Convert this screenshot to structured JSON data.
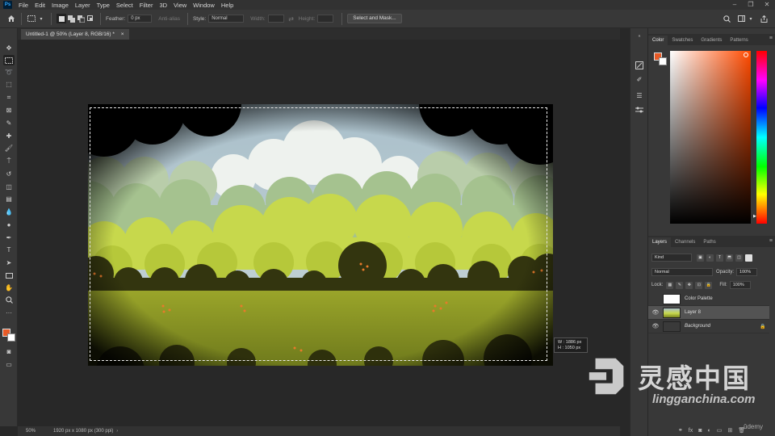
{
  "menubar": {
    "logo": "Ps",
    "items": [
      "File",
      "Edit",
      "Image",
      "Layer",
      "Type",
      "Select",
      "Filter",
      "3D",
      "View",
      "Window",
      "Help"
    ],
    "window_controls": [
      "–",
      "❐",
      "✕"
    ]
  },
  "options": {
    "feather_label": "Feather:",
    "feather_value": "0 px",
    "antialias_label": "Anti-alias",
    "style_label": "Style:",
    "style_value": "Normal",
    "width_label": "Width:",
    "height_label": "Height:",
    "select_mask_button": "Select and Mask..."
  },
  "document": {
    "tab_title": "Untitled-1 @ 50% (Layer 8, RGB/16) *",
    "close": "×"
  },
  "size_tooltip": {
    "w": "W :  1886 px",
    "h": "H :  1050 px"
  },
  "status": {
    "zoom": "50%",
    "info": "1920 px x 1080 px (300 ppi)"
  },
  "color_panel": {
    "tabs": [
      "Color",
      "Swatches",
      "Gradients",
      "Patterns"
    ],
    "active_tab": "Color",
    "foreground": "#e85a26",
    "background": "#ffffff"
  },
  "layers_panel": {
    "tabs": [
      "Layers",
      "Channels",
      "Paths"
    ],
    "active_tab": "Layers",
    "kind_filter": "Kind",
    "blend_mode": "Normal",
    "opacity_label": "Opacity:",
    "opacity_value": "100%",
    "lock_label": "Lock:",
    "fill_label": "Fill:",
    "fill_value": "100%",
    "layers": [
      {
        "name": "Color Palette",
        "visible": false,
        "selected": false
      },
      {
        "name": "Layer 8",
        "visible": true,
        "selected": true
      },
      {
        "name": "Background",
        "visible": true,
        "selected": false,
        "locked": true
      }
    ]
  },
  "watermark": {
    "chinese": "灵感中国",
    "domain": "lingganchina.com"
  },
  "udemy": "ûdemy"
}
